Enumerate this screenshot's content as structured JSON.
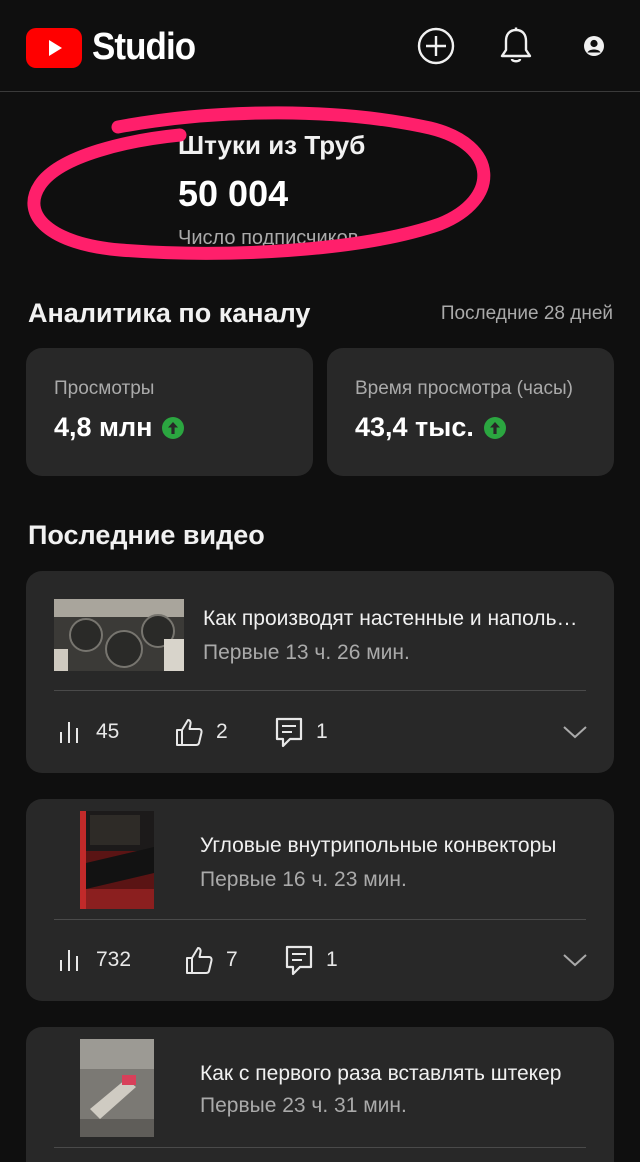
{
  "header": {
    "logo_text": "Studio",
    "icons": [
      "create-icon",
      "bell-icon",
      "account-icon"
    ]
  },
  "channel": {
    "name": "Штуки из Труб",
    "subscribers": "50 004",
    "subscribers_label": "Число подписчиков"
  },
  "analytics": {
    "title": "Аналитика по каналу",
    "period": "Последние 28 дней",
    "metrics": [
      {
        "label": "Просмотры",
        "value": "4,8 млн",
        "trend": "up"
      },
      {
        "label": "Время просмотра (часы)",
        "value": "43,4 тыс.",
        "trend": "up"
      }
    ]
  },
  "recent": {
    "title": "Последние видео",
    "videos": [
      {
        "title": "Как производят настенные и напольные",
        "meta": "Первые 13 ч. 26 мин.",
        "views": "45",
        "likes": "2",
        "comments": "1"
      },
      {
        "title": "Угловые внутрипольные конвекторы",
        "meta": "Первые 16 ч. 23 мин.",
        "views": "732",
        "likes": "7",
        "comments": "1"
      },
      {
        "title": "Как с первого раза вставлять штекер",
        "meta": "Первые 23 ч. 31 мин."
      }
    ]
  },
  "colors": {
    "background": "#0f0f0f",
    "card": "#282828",
    "brand_red": "#ff0000",
    "trend_green": "#2ba640",
    "annotation_pink": "#ff1f6b"
  }
}
